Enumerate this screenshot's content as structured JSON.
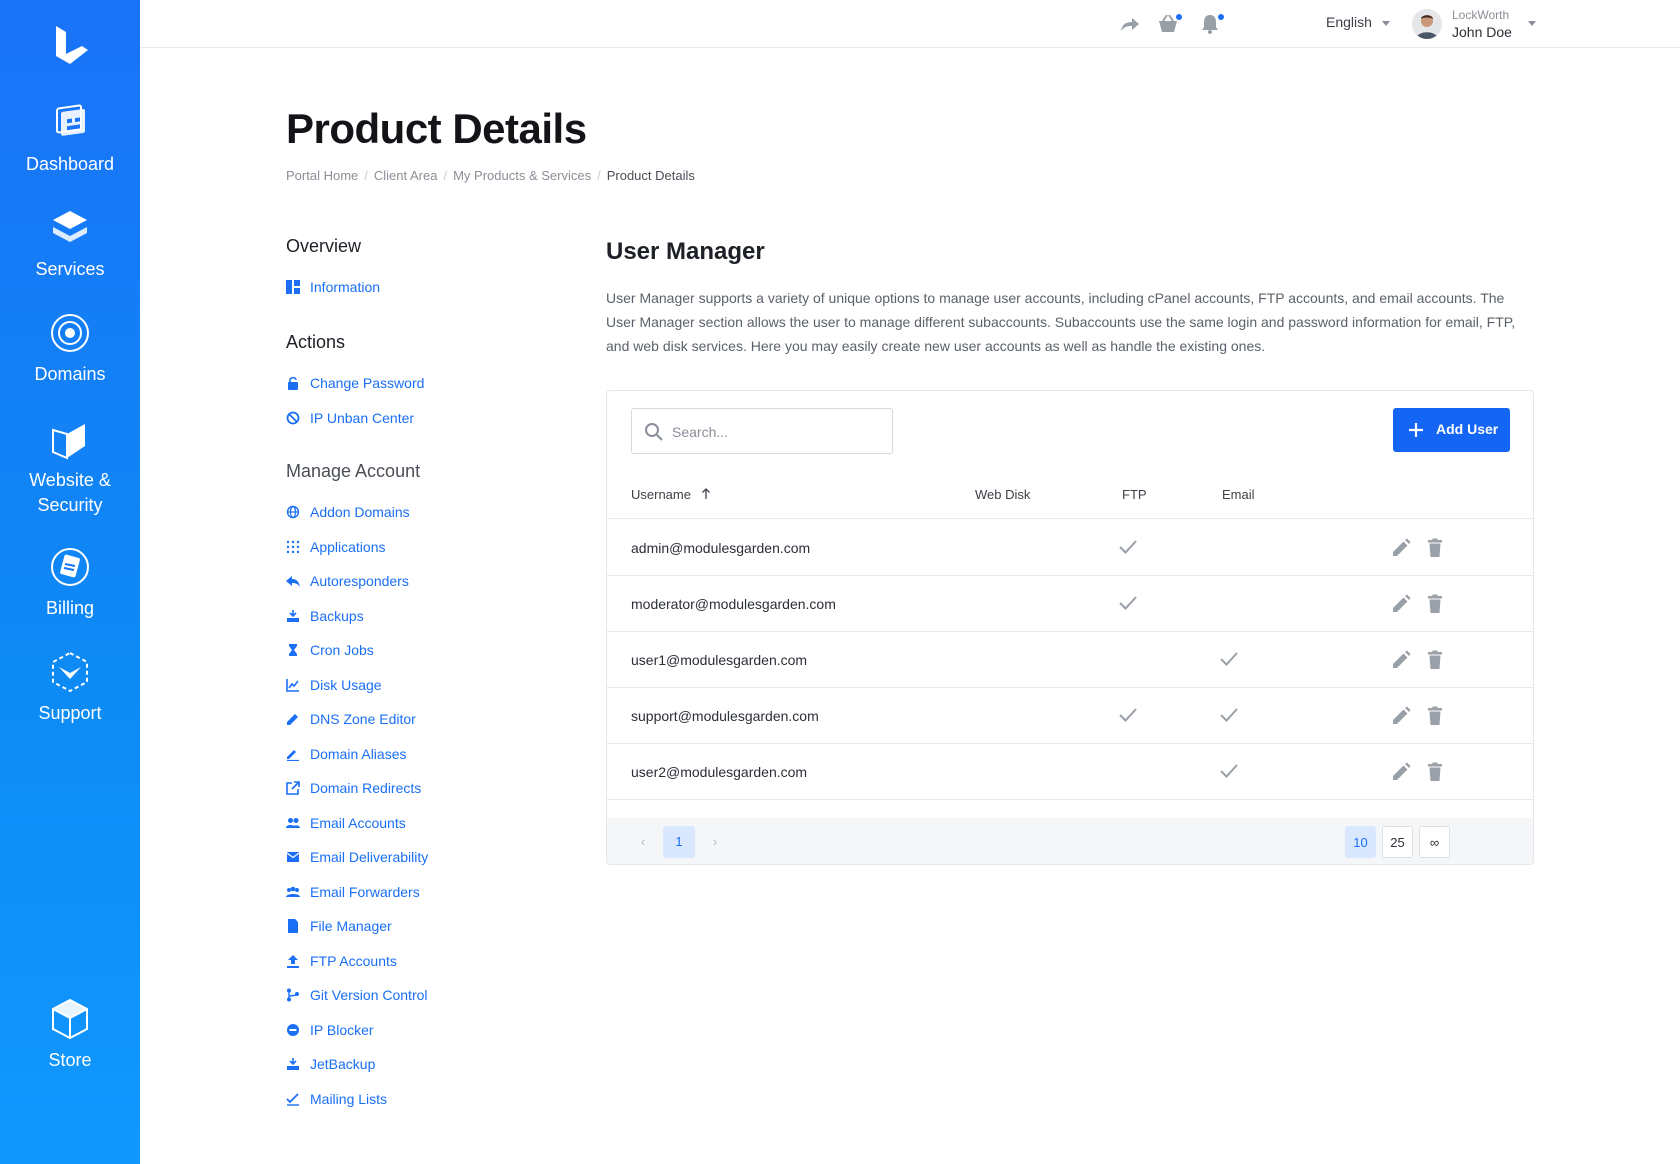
{
  "nav": {
    "items": [
      {
        "label": "Dashboard"
      },
      {
        "label": "Services"
      },
      {
        "label": "Domains"
      },
      {
        "label": "Website &",
        "label2": "Security"
      },
      {
        "label": "Billing"
      },
      {
        "label": "Support"
      },
      {
        "label": "Store"
      }
    ]
  },
  "topbar": {
    "language": "English",
    "company": "LockWorth",
    "username": "John Doe"
  },
  "page": {
    "title": "Product Details",
    "breadcrumb": [
      "Portal Home",
      "Client Area",
      "My Products & Services",
      "Product Details"
    ]
  },
  "sidemenu": {
    "overview_heading": "Overview",
    "overview_items": [
      "Information"
    ],
    "actions_heading": "Actions",
    "actions_items": [
      "Change Password",
      "IP Unban Center"
    ],
    "manage_heading": "Manage Account",
    "manage_items": [
      "Addon Domains",
      "Applications",
      "Autoresponders",
      "Backups",
      "Cron Jobs",
      "Disk Usage",
      "DNS Zone Editor",
      "Domain Aliases",
      "Domain Redirects",
      "Email Accounts",
      "Email Deliverability",
      "Email Forwarders",
      "File Manager",
      "FTP Accounts",
      "Git Version Control",
      "IP Blocker",
      "JetBackup",
      "Mailing Lists"
    ]
  },
  "content": {
    "title": "User Manager",
    "description": "User Manager supports a variety of unique options to manage user accounts, including cPanel accounts, FTP accounts, and email accounts. The User Manager section allows the user to manage different subaccounts. Subaccounts use the same login and password information for email, FTP, and web disk services. Here you may easily create new user accounts as well as handle the existing ones.",
    "search_placeholder": "Search...",
    "add_user_label": "Add User",
    "columns": [
      "Username",
      "Web Disk",
      "FTP",
      "Email"
    ],
    "rows": [
      {
        "username": "admin@modulesgarden.com",
        "web_disk": false,
        "ftp": true,
        "email": false
      },
      {
        "username": "moderator@modulesgarden.com",
        "web_disk": false,
        "ftp": true,
        "email": false
      },
      {
        "username": "user1@modulesgarden.com",
        "web_disk": false,
        "ftp": false,
        "email": true
      },
      {
        "username": "support@modulesgarden.com",
        "web_disk": false,
        "ftp": true,
        "email": true
      },
      {
        "username": "user2@modulesgarden.com",
        "web_disk": false,
        "ftp": false,
        "email": true
      }
    ],
    "pagination": {
      "prev": "‹",
      "current_page": "1",
      "next": "›",
      "page_sizes": [
        "10",
        "25",
        "∞"
      ],
      "active_size": "10"
    }
  },
  "colors": {
    "accent": "#1a6ff5",
    "sidebar": "#1a73f8",
    "button": "#1565f5"
  }
}
